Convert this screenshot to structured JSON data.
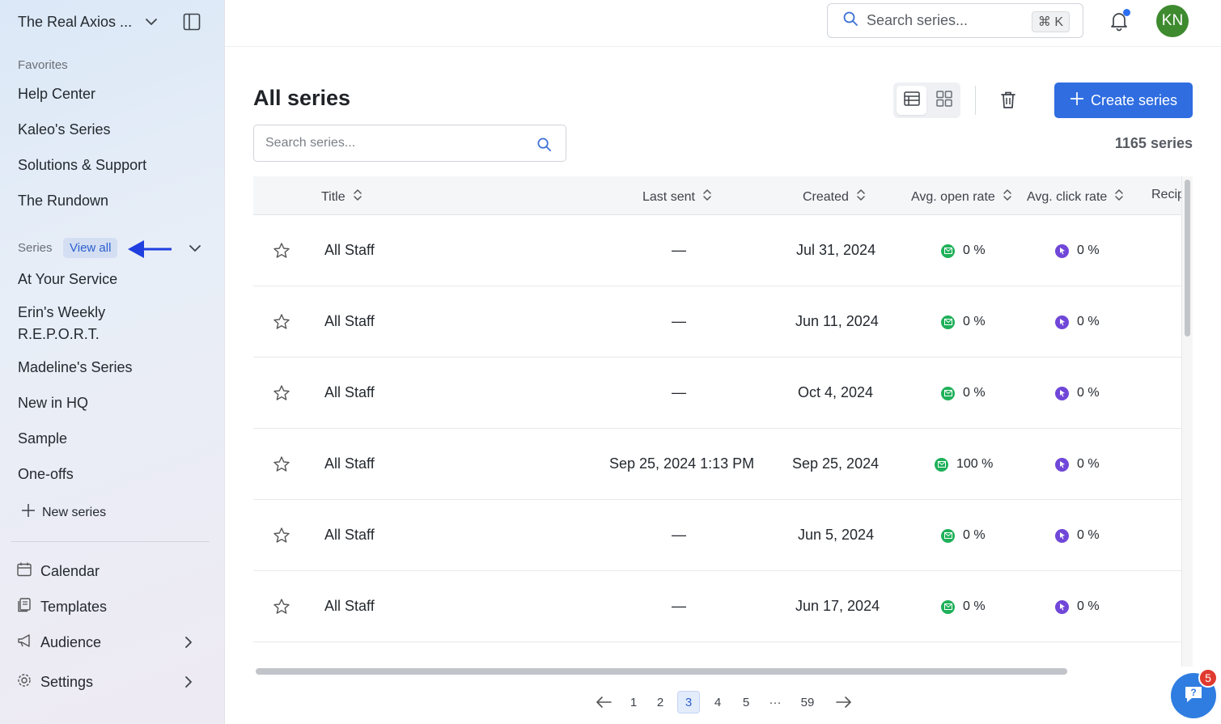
{
  "workspace": {
    "name": "The Real Axios ..."
  },
  "sidebar": {
    "favorites_label": "Favorites",
    "favorites": [
      {
        "label": "Help Center"
      },
      {
        "label": "Kaleo's Series"
      },
      {
        "label": "Solutions & Support"
      },
      {
        "label": "The Rundown"
      }
    ],
    "series_label": "Series",
    "view_all_label": "View all",
    "series": [
      {
        "label": "At Your Service"
      },
      {
        "label": "Erin's Weekly R.E.P.O.R.T."
      },
      {
        "label": "Madeline's Series"
      },
      {
        "label": "New in HQ"
      },
      {
        "label": "Sample"
      },
      {
        "label": "One-offs"
      }
    ],
    "new_series_label": "New series",
    "bottom": [
      {
        "label": "Calendar",
        "icon": "calendar-icon"
      },
      {
        "label": "Templates",
        "icon": "templates-icon"
      },
      {
        "label": "Audience",
        "icon": "megaphone-icon"
      },
      {
        "label": "Settings",
        "icon": "gear-icon"
      }
    ]
  },
  "topbar": {
    "search_placeholder": "Search series...",
    "shortcut": "⌘ K",
    "avatar_initials": "KN",
    "avatar_color": "#3e8a2f"
  },
  "main": {
    "title": "All series",
    "create_label": "Create series",
    "search_placeholder": "Search series...",
    "count": "1165 series",
    "accent": "#2f6de1"
  },
  "table": {
    "columns": [
      "Title",
      "Last sent",
      "Created",
      "Avg. open rate",
      "Avg. click rate",
      "Recip"
    ],
    "rows": [
      {
        "title": "All Staff",
        "last_sent": "—",
        "created": "Jul 31, 2024",
        "open_rate": "0 %",
        "click_rate": "0 %"
      },
      {
        "title": "All Staff",
        "last_sent": "—",
        "created": "Jun 11, 2024",
        "open_rate": "0 %",
        "click_rate": "0 %"
      },
      {
        "title": "All Staff",
        "last_sent": "—",
        "created": "Oct 4, 2024",
        "open_rate": "0 %",
        "click_rate": "0 %"
      },
      {
        "title": "All Staff",
        "last_sent": "Sep 25, 2024 1:13 PM",
        "created": "Sep 25, 2024",
        "open_rate": "100 %",
        "click_rate": "0 %"
      },
      {
        "title": "All Staff",
        "last_sent": "—",
        "created": "Jun 5, 2024",
        "open_rate": "0 %",
        "click_rate": "0 %"
      },
      {
        "title": "All Staff",
        "last_sent": "—",
        "created": "Jun 17, 2024",
        "open_rate": "0 %",
        "click_rate": "0 %"
      }
    ]
  },
  "pagination": {
    "pages": [
      "1",
      "2",
      "3",
      "4",
      "5",
      "···",
      "59"
    ],
    "current": "3"
  },
  "help": {
    "badge_count": "5"
  }
}
